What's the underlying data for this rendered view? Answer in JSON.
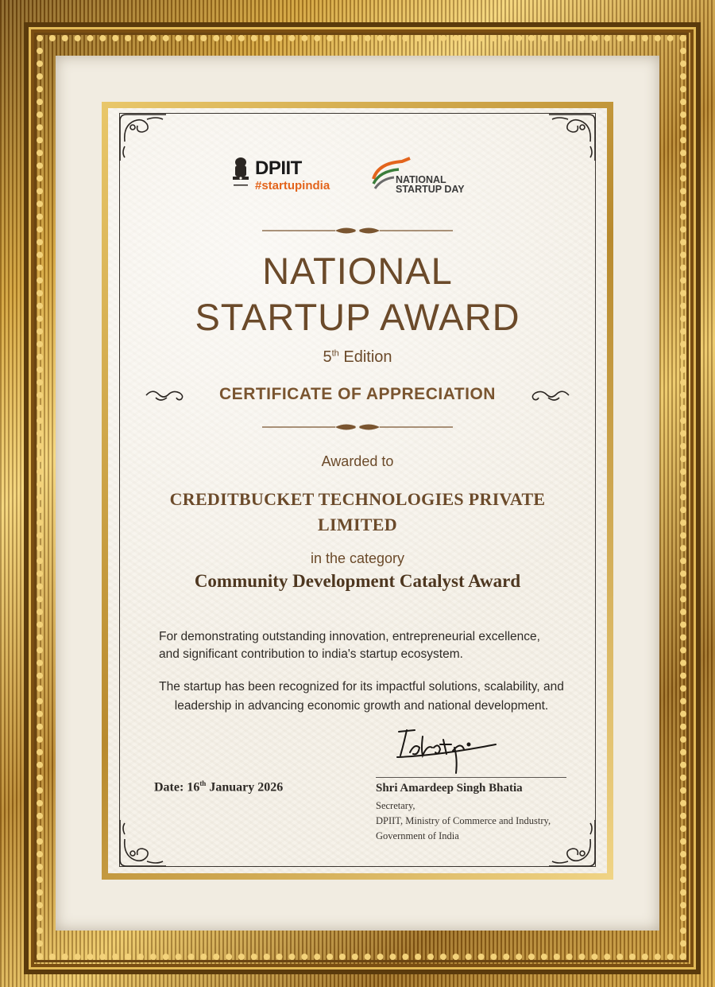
{
  "logos": {
    "dpiit": "DPIIT",
    "startupindia": "#startupindia",
    "nsd_line1": "NATIONAL",
    "nsd_line2": "STARTUP DAY"
  },
  "certificate": {
    "title_line1": "NATIONAL",
    "title_line2": "STARTUP AWARD",
    "edition_num": "5",
    "edition_sup": "th",
    "edition_word": "Edition",
    "heading": "CERTIFICATE OF APPRECIATION",
    "awarded_to": "Awarded to",
    "company_line1": "CREDITBUCKET TECHNOLOGIES PRIVATE",
    "company_line2": "LIMITED",
    "category_intro": "in the category",
    "category": "Community Development Catalyst Award",
    "para1": "For demonstrating outstanding innovation, entrepreneurial excellence, and significant contribution to india's startup ecosystem.",
    "para2": "The startup has been recognized for its impactful solutions, scalability, and leadership in advancing economic growth and national development."
  },
  "footer": {
    "date_prefix": "Date: 16",
    "date_sup": "th",
    "date_suffix": " January 2026",
    "signer_name": "Shri Amardeep Singh Bhatia",
    "signer_title": "Secretary,",
    "signer_org": "DPIIT, Ministry of Commerce and Industry,",
    "signer_gov": "Government of India"
  },
  "colors": {
    "frame_gold": "#c9962e",
    "text_brown": "#6b4a2a",
    "saffron": "#e3641c"
  }
}
